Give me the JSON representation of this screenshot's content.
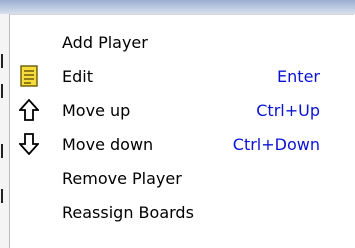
{
  "menu": {
    "items": [
      {
        "label": "Add Player",
        "shortcut": "",
        "icon": ""
      },
      {
        "label": "Edit",
        "shortcut": "Enter",
        "icon": "edit-note-icon"
      },
      {
        "label": "Move up",
        "shortcut": "Ctrl+Up",
        "icon": "arrow-up-icon"
      },
      {
        "label": "Move down",
        "shortcut": "Ctrl+Down",
        "icon": "arrow-down-icon"
      },
      {
        "label": "Remove Player",
        "shortcut": "",
        "icon": ""
      },
      {
        "label": "Reassign Boards",
        "shortcut": "",
        "icon": ""
      }
    ]
  },
  "colors": {
    "shortcut_text": "#0a14d4",
    "edit_icon_fill": "#f6dc3c"
  }
}
